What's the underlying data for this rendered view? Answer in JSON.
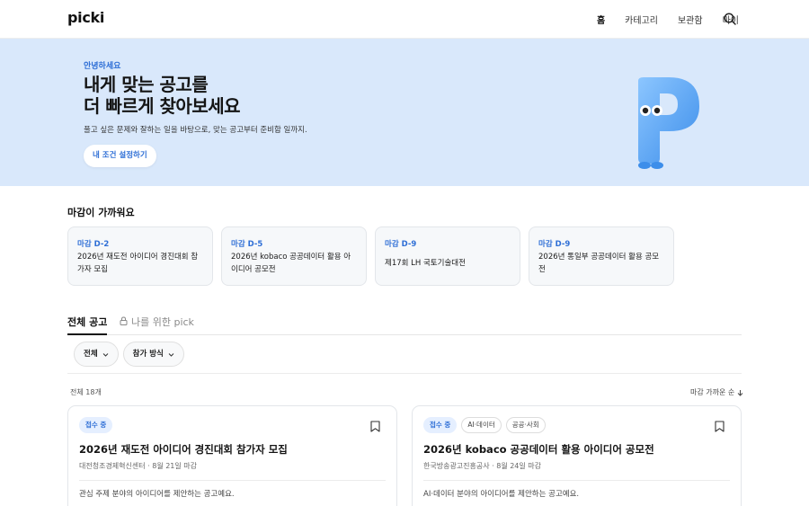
{
  "header": {
    "logo": "picki",
    "nav": [
      {
        "label": "홈"
      },
      {
        "label": "카테고리"
      },
      {
        "label": "보관함"
      },
      {
        "label": "마이"
      }
    ]
  },
  "hero": {
    "greeting": "안녕하세요",
    "title_line1": "내게 맞는 공고를",
    "title_line2": "더 빠르게 찾아보세요",
    "subtitle": "풀고 싶은 문제와 잘하는 일을 바탕으로, 맞는 공고부터 준비함 일까지.",
    "cta": "내 조건 설정하기"
  },
  "deadlines": {
    "title": "마감이 가까워요",
    "items": [
      {
        "badge": "마감 D-2",
        "line1": "2026년 재도전 아이디어 경진대회 참",
        "line2": "가자 모집"
      },
      {
        "badge": "마감 D-5",
        "line1": "2026년 kobaco 공공데이터 활용 아",
        "line2": "이디어 공모전"
      },
      {
        "badge": "마감 D-9",
        "line1": "제17회 LH 국토기술대전",
        "line2": ""
      },
      {
        "badge": "마감 D-9",
        "line1": "2026년 통일부 공공데이터 활용 공모",
        "line2": "전"
      }
    ]
  },
  "tabs": {
    "all": "전체 공고",
    "pick": "나를 위한 pick"
  },
  "filters": {
    "all": "전체",
    "method": "참가 방식"
  },
  "list": {
    "count": "전체 18개",
    "sort": "마감 가까운 순"
  },
  "jobs": [
    {
      "tags": [
        "접수 중"
      ],
      "title": "2026년 재도전 아이디어 경진대회 참가자 모집",
      "meta": "대전청조경제혁신센터 · 8월 21일 마감",
      "desc": "관심 주제 분야의 아이디어를 제안하는 공고예요."
    },
    {
      "tags": [
        "접수 중",
        "AI·데이터",
        "공공·사회"
      ],
      "title": "2026년 kobaco 공공데이터 활용 아이디어 공모전",
      "meta": "한국방송광고진흥공사 · 8월 24일 마감",
      "desc": "AI·데이터 분야의 아이디어를 제안하는 공고예요."
    }
  ],
  "colors": {
    "accent": "#2f6fd6",
    "hero_bg": "#d9e8fb",
    "mascot": "#5aa7f5"
  }
}
